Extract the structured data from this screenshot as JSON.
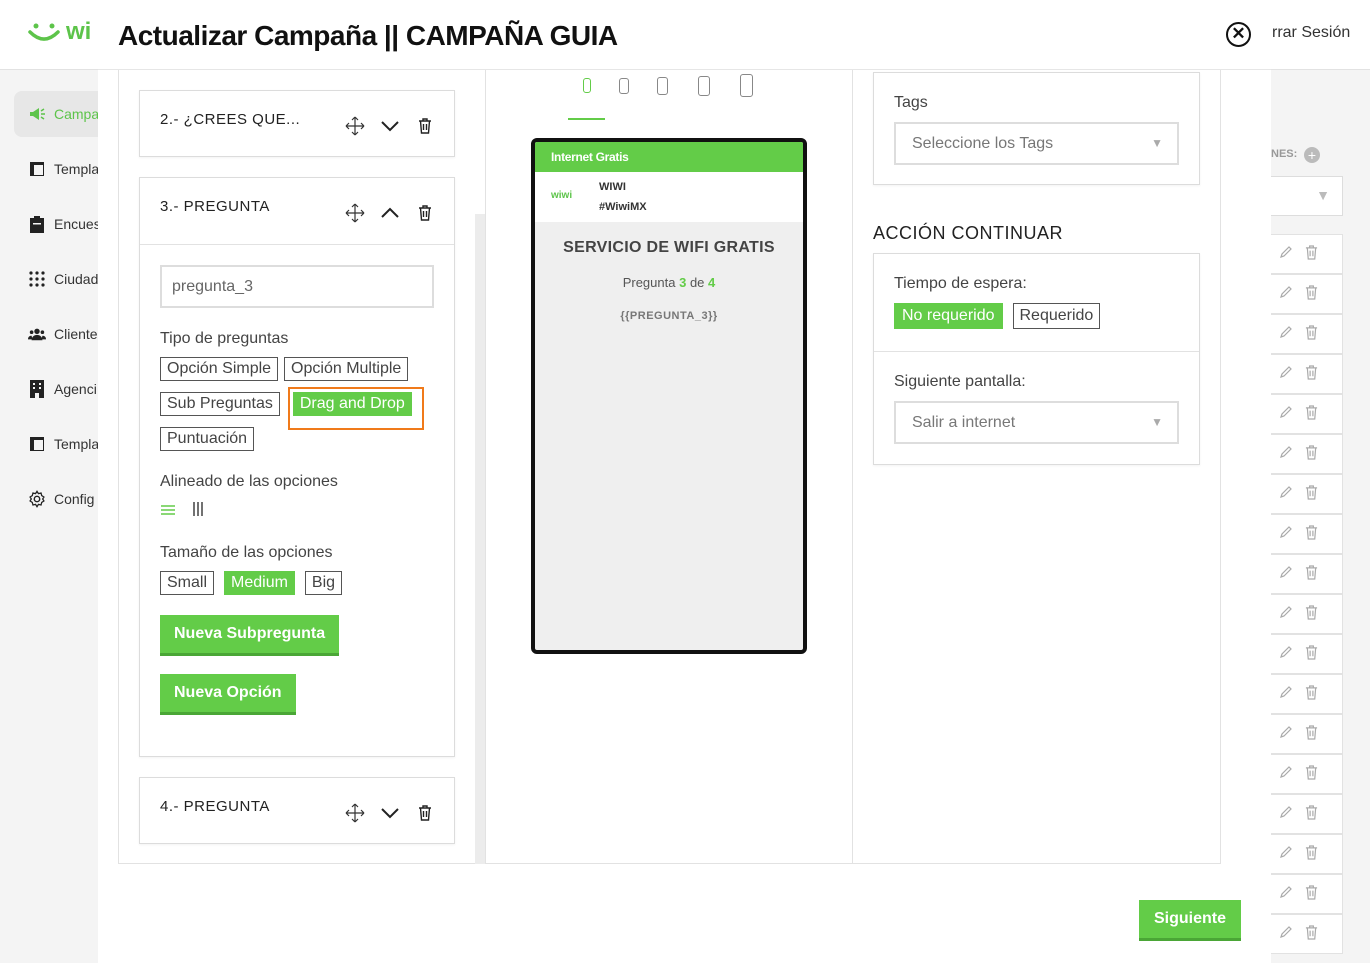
{
  "app": {
    "logo_text": "wi",
    "logout_label": "rrar Sesión",
    "sidebar": [
      {
        "label": "Campa",
        "icon": "megaphone-icon",
        "active": true
      },
      {
        "label": "Templa",
        "icon": "template-icon"
      },
      {
        "label": "Encues",
        "icon": "clipboard-icon"
      },
      {
        "label": "Ciudad",
        "icon": "grid-dots-icon"
      },
      {
        "label": "Cliente",
        "icon": "users-icon"
      },
      {
        "label": "Agenci",
        "icon": "building-icon"
      },
      {
        "label": "Templa",
        "icon": "template-icon"
      },
      {
        "label": "Config",
        "icon": "gear-icon"
      }
    ],
    "right_label": "NES:"
  },
  "modal": {
    "title": "Actualizar Campaña || CAMPAÑA GUIA",
    "next_label": "Siguiente"
  },
  "questions": {
    "q2": {
      "title": "2.- ¿CREES QUE..."
    },
    "q3": {
      "title": "3.- PREGUNTA",
      "input_value": "pregunta_3",
      "tipo_label": "Tipo de preguntas",
      "tipos": [
        "Opción Simple",
        "Opción Multiple",
        "Sub Preguntas",
        "Drag and Drop",
        "Puntuación"
      ],
      "tipo_selected": "Drag and Drop",
      "alineado_label": "Alineado de las opciones",
      "tamano_label": "Tamaño de las opciones",
      "tamanos": [
        "Small",
        "Medium",
        "Big"
      ],
      "tamano_selected": "Medium",
      "nueva_subpregunta": "Nueva Subpregunta",
      "nueva_opcion": "Nueva Opción"
    },
    "q4": {
      "title": "4.- PREGUNTA"
    }
  },
  "preview": {
    "bar_text": "Internet Gratis",
    "logo_text": "wiwi",
    "brand_name": "WIWI",
    "brand_tag": "#WiwiMX",
    "title": "SERVICIO DE WIFI GRATIS",
    "count_prefix": "Pregunta",
    "count_current": "3",
    "count_sep": "de",
    "count_total": "4",
    "placeholder": "{{PREGUNTA_3}}"
  },
  "settings": {
    "tags_label": "Tags",
    "tags_placeholder": "Seleccione los Tags",
    "section_title": "ACCIÓN CONTINUAR",
    "tiempo_label": "Tiempo de espera:",
    "tiempo_options": [
      "No requerido",
      "Requerido"
    ],
    "tiempo_selected": "No requerido",
    "siguiente_label": "Siguiente pantalla:",
    "siguiente_value": "Salir a internet"
  },
  "colors": {
    "accent": "#63cc48",
    "highlight": "#f07a1a"
  }
}
